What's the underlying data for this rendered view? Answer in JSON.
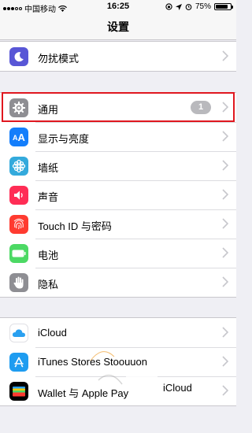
{
  "status_bar": {
    "carrier": "中国移动",
    "time": "16:25",
    "battery": "75%",
    "battery_level": 0.75
  },
  "nav": {
    "title": "设置"
  },
  "group1": [
    {
      "label": "勿扰模式",
      "icon": "moon-icon",
      "color": "#5856d6"
    }
  ],
  "group2": [
    {
      "label": "通用",
      "icon": "gear-icon",
      "color": "#8e8e93",
      "badge": "1"
    },
    {
      "label": "显示与亮度",
      "icon": "text-size-icon",
      "color": "#147efb"
    },
    {
      "label": "墙纸",
      "icon": "flower-icon",
      "color": "#34aadc"
    },
    {
      "label": "声音",
      "icon": "speaker-icon",
      "color": "#ff2d55"
    },
    {
      "label": "Touch ID 与密码",
      "icon": "fingerprint-icon",
      "color": "#ff3b30"
    },
    {
      "label": "电池",
      "icon": "battery-icon",
      "color": "#4cd964"
    },
    {
      "label": "隐私",
      "icon": "hand-icon",
      "color": "#8e8e93"
    }
  ],
  "group3": [
    {
      "label": "iCloud",
      "icon": "cloud-icon",
      "color": "#ffffff"
    },
    {
      "label": "iTunes Stores Stoouuon",
      "icon": "app-store-icon",
      "color": "#1e9cf0"
    },
    {
      "label": "Wallet 与 Apple Pay",
      "icon": "wallet-icon",
      "color": "#000000"
    }
  ],
  "overlay_text": "iCloud"
}
